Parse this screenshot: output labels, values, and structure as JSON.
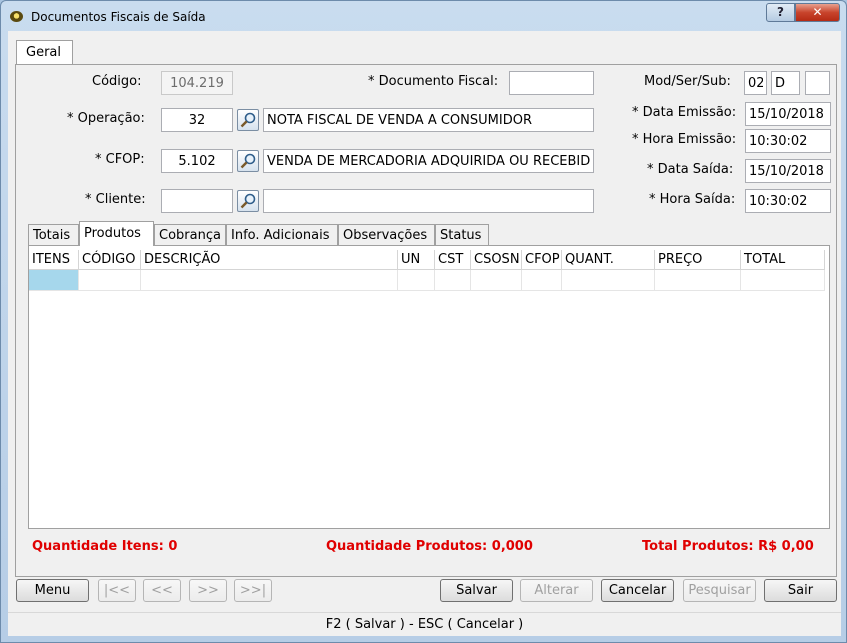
{
  "window": {
    "title": "Documentos Fiscais de Saída",
    "help_glyph": "?",
    "close_glyph": "✕"
  },
  "tabs": {
    "main": "Geral"
  },
  "form": {
    "codigo": {
      "label": "Código:",
      "value": "104.219"
    },
    "documento_fiscal": {
      "label": "* Documento Fiscal:",
      "value": ""
    },
    "mod_ser_sub": {
      "label": "Mod/Ser/Sub:",
      "mod": "02",
      "ser": "D",
      "sub": ""
    },
    "operacao": {
      "label": "* Operação:",
      "code": "32",
      "description": "NOTA FISCAL DE VENDA A CONSUMIDOR"
    },
    "data_emissao": {
      "label": "* Data Emissão:",
      "value": "15/10/2018"
    },
    "hora_emissao": {
      "label": "* Hora Emissão:",
      "value": "10:30:02"
    },
    "cfop": {
      "label": "* CFOP:",
      "code": "5.102",
      "description": "VENDA DE MERCADORIA ADQUIRIDA OU RECEBIDA"
    },
    "data_saida": {
      "label": "* Data Saída:",
      "value": "15/10/2018"
    },
    "cliente": {
      "label": "* Cliente:",
      "code": "",
      "description": ""
    },
    "hora_saida": {
      "label": "* Hora Saída:",
      "value": "10:30:02"
    }
  },
  "subtabs": [
    "Totais",
    "Produtos",
    "Cobrança",
    "Info. Adicionais",
    "Observações",
    "Status"
  ],
  "grid": {
    "columns": [
      "ITENS",
      "CÓDIGO",
      "DESCRIÇÃO",
      "UN",
      "CST",
      "CSOSN",
      "CFOP",
      "QUANT.",
      "PREÇO",
      "TOTAL"
    ]
  },
  "summary": {
    "itens": "Quantidade Itens: 0",
    "produtos": "Quantidade Produtos: 0,000",
    "total": "Total Produtos: R$ 0,00"
  },
  "buttons": {
    "menu": "Menu",
    "first": "|<<",
    "prev": "<<",
    "next": ">>",
    "last": ">>|",
    "salvar": "Salvar",
    "alterar": "Alterar",
    "cancelar": "Cancelar",
    "pesquisar": "Pesquisar",
    "sair": "Sair"
  },
  "status_bar": "F2 ( Salvar )   -   ESC ( Cancelar )"
}
